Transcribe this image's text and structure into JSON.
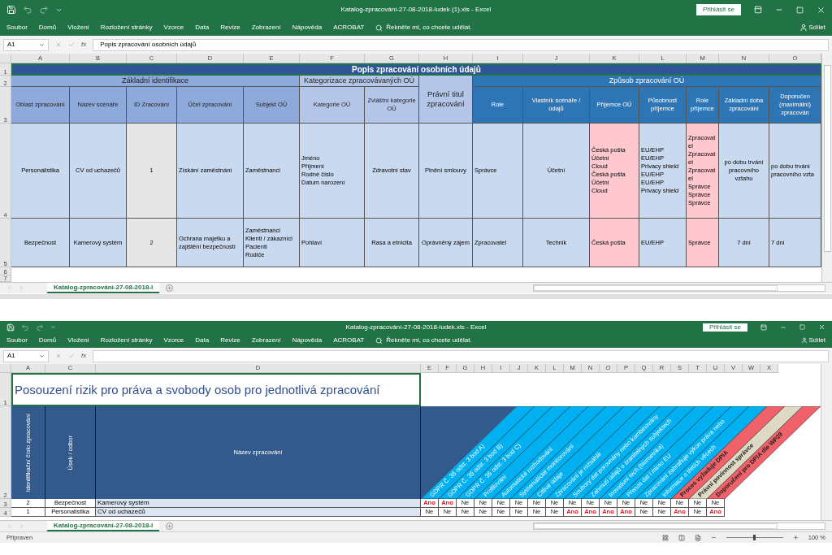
{
  "catalog_window": {
    "title": "Katalog-zpracování-27-08-2018-ludek (1).xls  -  Excel",
    "sign_in": "Přihlásit se",
    "ribbon_tabs": [
      "Soubor",
      "Domů",
      "Vložení",
      "Rozložení stránky",
      "Vzorce",
      "Data",
      "Revize",
      "Zobrazení",
      "Nápověda",
      "ACROBAT"
    ],
    "tell_me": "Řekněte mi, co chcete udělat.",
    "share": "Sdílet",
    "name_box": "A1",
    "fx": "fx",
    "formula": "Popis zpracování osobních údajů",
    "column_letters": [
      "A",
      "B",
      "C",
      "D",
      "E",
      "F",
      "G",
      "H",
      "I",
      "J",
      "K",
      "L",
      "M",
      "N",
      "O"
    ],
    "row_numbers": [
      "1",
      "2",
      "3",
      "4",
      "5",
      "6",
      "7"
    ],
    "sheet_title": "Popis zpracování osobních údajů",
    "groups": [
      {
        "label": "Základní identifikace",
        "kind": "basic"
      },
      {
        "label": "Kategorizace zpracovávaných OÚ",
        "kind": "category"
      },
      {
        "label": "Způsob zpracování OÚ",
        "kind": "processing"
      }
    ],
    "columns": [
      {
        "label": "Oblast zpracování",
        "kind": "basic"
      },
      {
        "label": "Název scénáře",
        "kind": "basic"
      },
      {
        "label": "ID Zracování",
        "kind": "basic"
      },
      {
        "label": "Účel zpracování",
        "kind": "basic"
      },
      {
        "label": "Subjekt OÚ",
        "kind": "basic"
      },
      {
        "label": "Kategorie OÚ",
        "kind": "category"
      },
      {
        "label": "Zvláštní kategorie OÚ",
        "kind": "category"
      },
      {
        "label": "Právní titul zpracování",
        "kind": "legal"
      },
      {
        "label": "Role",
        "kind": "processing"
      },
      {
        "label": "Vlastník scénáře / údajů",
        "kind": "processing"
      },
      {
        "label": "Příjemce OÚ",
        "kind": "processing"
      },
      {
        "label": "Působnost příjemce",
        "kind": "processing"
      },
      {
        "label": "Role příjemce",
        "kind": "processing"
      },
      {
        "label": "Základní doba zpracování",
        "kind": "processing"
      },
      {
        "label": "Doporučen\n(maximální)\nzpracován",
        "kind": "processing"
      }
    ],
    "rows": [
      {
        "cells": [
          {
            "text": "Personalistika",
            "kind": "plain"
          },
          {
            "text": "CV od uchazečů",
            "kind": "plain"
          },
          {
            "text": "1",
            "kind": "id"
          },
          {
            "text": "Získání zaměstnání",
            "kind": "plain"
          },
          {
            "text": "Zaměstnanci",
            "kind": "plain"
          },
          {
            "text": "Jméno\nPříjmení\nRodné číslo\nDatum narození",
            "kind": "plain"
          },
          {
            "text": "Zdravotní stav",
            "kind": "plain"
          },
          {
            "text": "Plnění smlouvy",
            "kind": "plain"
          },
          {
            "text": "Správce",
            "kind": "plain"
          },
          {
            "text": "Účetní",
            "kind": "plain"
          },
          {
            "text": "Česká pošta\nÚčetní\nCloud\nČeská pošta\nÚčetní\nCloud",
            "kind": "recipient"
          },
          {
            "text": "EU/EHP\nEU/EHP\nPrivacy shield\nEU/EHP\nEU/EHP\nPrivacy shield",
            "kind": "plain"
          },
          {
            "text": "Zpracovatel\nZpracovatel\nZpracovatel\nSprávce\nSprávce\nSprávce",
            "kind": "recipient"
          },
          {
            "text": "po dobu trvání pracovního vztahu",
            "kind": "plain"
          },
          {
            "text": "po dobu trvání\npracovního vzta",
            "kind": "plain"
          }
        ]
      },
      {
        "cells": [
          {
            "text": "Bezpečnost",
            "kind": "plain"
          },
          {
            "text": "Kamerový systém",
            "kind": "plain"
          },
          {
            "text": "2",
            "kind": "id"
          },
          {
            "text": "Ochrana majetku a zajištění bezpečnosti",
            "kind": "plain"
          },
          {
            "text": "Zaměstnanci\nKlienti / zákazníci\nPacienti\nRodiče",
            "kind": "plain"
          },
          {
            "text": "Pohlaví",
            "kind": "plain"
          },
          {
            "text": "Rasa a etnicita",
            "kind": "plain"
          },
          {
            "text": "Oprávněný zájem",
            "kind": "plain"
          },
          {
            "text": "Zpracovatel",
            "kind": "plain"
          },
          {
            "text": "Technik",
            "kind": "plain"
          },
          {
            "text": "Česká pošta",
            "kind": "recipient"
          },
          {
            "text": "EU/EHP",
            "kind": "plain"
          },
          {
            "text": "Správce",
            "kind": "recipient"
          },
          {
            "text": "7 dní",
            "kind": "plain"
          },
          {
            "text": "7 dní",
            "kind": "plain"
          }
        ]
      }
    ],
    "sheet_tab": "Katalog-zpracování-27-08-2018-l"
  },
  "risk_window": {
    "title": "Katalog-zpracování-27-08-2018-ludek.xls  -  Excel",
    "sign_in": "Přihlásit se",
    "ribbon_tabs": [
      "Soubor",
      "Domů",
      "Vložení",
      "Rozložení stránky",
      "Vzorce",
      "Data",
      "Revize",
      "Zobrazení",
      "Nápověda",
      "ACROBAT"
    ],
    "tell_me": "Řekněte mi, co chcete udělat.",
    "share": "Sdílet",
    "name_box": "A1",
    "fx": "fx",
    "column_letters": [
      "A",
      "C",
      "D",
      "E",
      "F",
      "G",
      "H",
      "I",
      "J",
      "K",
      "L",
      "M",
      "N",
      "O",
      "P",
      "Q",
      "R",
      "S",
      "T",
      "U",
      "V",
      "W",
      "X"
    ],
    "row_numbers": [
      "1",
      "2",
      "3",
      "4"
    ],
    "sheet_title": "Posouzení rizik pro práva a svobody osob pro jednotlivá zpracování",
    "left_headers": [
      "Identifikační číslo zpracování",
      "Úsek / odbor",
      "Název zpracování"
    ],
    "criteria": [
      {
        "label": "GDPR Č. 35 odst. 3 bod A)",
        "kind": "criterion"
      },
      {
        "label": "GDPR Č. 35 odst. 3 bod B)",
        "kind": "criterion"
      },
      {
        "label": "GDPR Č. 35 odst. 3 bod C)",
        "kind": "criterion"
      },
      {
        "label": "Profilování",
        "kind": "criterion"
      },
      {
        "label": "Automatické rozhodování",
        "kind": "criterion"
      },
      {
        "label": "Systematické monitorování",
        "kind": "criterion"
      },
      {
        "label": "Citlivé údaje",
        "kind": "criterion"
      },
      {
        "label": "Zpracování je rozsáhlé",
        "kind": "criterion"
      },
      {
        "label": "Soubory dat porovnány nebo kombinovány",
        "kind": "criterion"
      },
      {
        "label": "Zahrnutí údajů o zranitelných subjektech",
        "kind": "criterion"
      },
      {
        "label": "Inovativní tech.(biometrika)",
        "kind": "criterion"
      },
      {
        "label": "Přenos dat i mimo EU",
        "kind": "criterion"
      },
      {
        "label": "Zpracování zabraňuje výkon práva nebo",
        "kind": "criterion"
      },
      {
        "label": "Informace o třetích věcech",
        "kind": "criterion"
      },
      {
        "label": "Proces vyžaduje DPIA",
        "kind": "dpia"
      },
      {
        "label": "Právní povinnost správce",
        "kind": "obligation"
      },
      {
        "label": "Doporučení pro DPIA dle WP29",
        "kind": "dpia"
      }
    ],
    "rows": [
      {
        "id": "2",
        "unit": "Bezpečnost",
        "name": "Kamerový systém",
        "flags": [
          {
            "text": "Ano",
            "flagged": true
          },
          {
            "text": "Ano",
            "flagged": true
          },
          {
            "text": "Ne",
            "flagged": false
          },
          {
            "text": "Ne",
            "flagged": false
          },
          {
            "text": "Ne",
            "flagged": false
          },
          {
            "text": "Ne",
            "flagged": false
          },
          {
            "text": "Ne",
            "flagged": false
          },
          {
            "text": "Ne",
            "flagged": false
          },
          {
            "text": "Ne",
            "flagged": false
          },
          {
            "text": "Ne",
            "flagged": false
          },
          {
            "text": "Ne",
            "flagged": false
          },
          {
            "text": "Ne",
            "flagged": false
          },
          {
            "text": "Ne",
            "flagged": false
          },
          {
            "text": "Ne",
            "flagged": false
          },
          {
            "text": "Ne",
            "flagged": false
          },
          {
            "text": "Ne",
            "flagged": false
          },
          {
            "text": "Ne",
            "flagged": false
          }
        ]
      },
      {
        "id": "1",
        "unit": "Personalistika",
        "name": "CV od uchazečů",
        "flags": [
          {
            "text": "Ne",
            "flagged": false
          },
          {
            "text": "Ne",
            "flagged": false
          },
          {
            "text": "Ne",
            "flagged": false
          },
          {
            "text": "Ne",
            "flagged": false
          },
          {
            "text": "Ne",
            "flagged": false
          },
          {
            "text": "Ne",
            "flagged": false
          },
          {
            "text": "Ne",
            "flagged": false
          },
          {
            "text": "Ne",
            "flagged": false
          },
          {
            "text": "Ano",
            "flagged": true
          },
          {
            "text": "Ano",
            "flagged": true
          },
          {
            "text": "Ano",
            "flagged": true
          },
          {
            "text": "Ano",
            "flagged": true
          },
          {
            "text": "Ne",
            "flagged": false
          },
          {
            "text": "Ne",
            "flagged": false
          },
          {
            "text": "Ano",
            "flagged": true
          },
          {
            "text": "Ne",
            "flagged": false
          },
          {
            "text": "Ano",
            "flagged": true
          }
        ]
      }
    ],
    "sheet_tab": "Katalog-zpracování-27-08-2018-l",
    "status": "Připraven",
    "zoom": {
      "level": 0.5,
      "reading": "100 %"
    }
  }
}
